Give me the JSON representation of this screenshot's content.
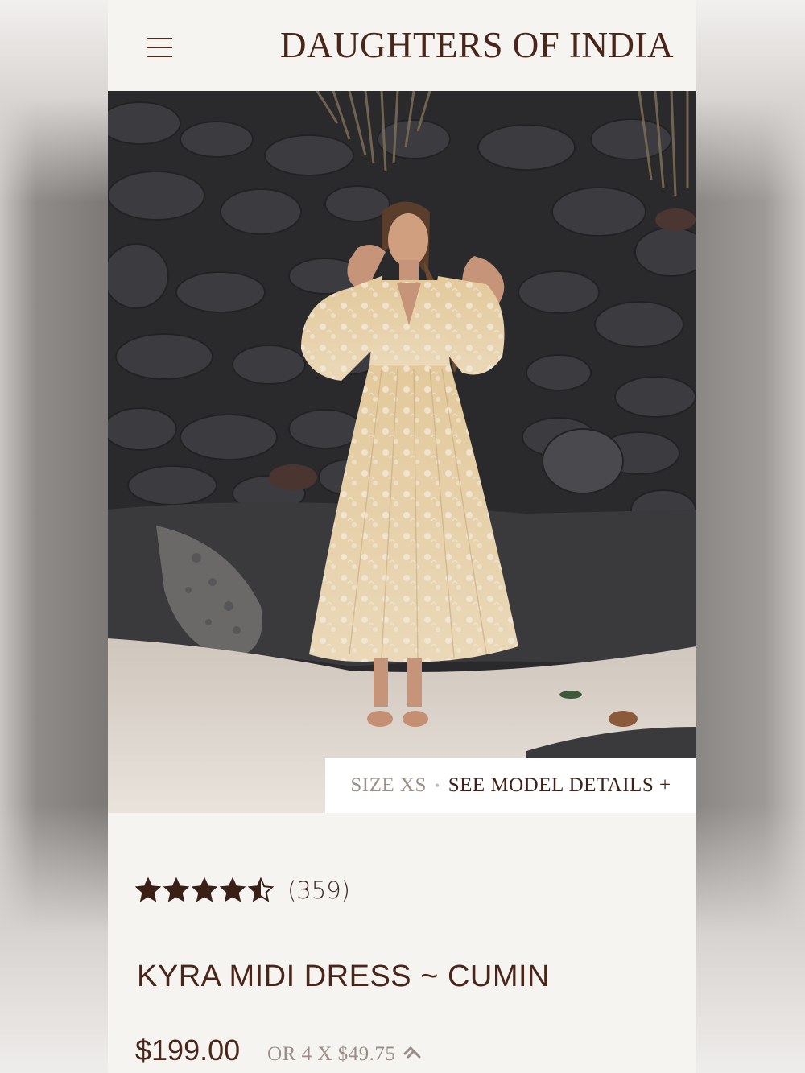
{
  "brand": {
    "name": "DAUGHTERS OF INDIA"
  },
  "hero": {
    "size_label": "SIZE XS",
    "separator": "•",
    "details_label": "SEE MODEL DETAILS +"
  },
  "product": {
    "rating_value": 4.5,
    "rating_max": 5,
    "review_count": "(359)",
    "title": "KYRA MIDI DRESS ~ CUMIN",
    "price": "$199.00",
    "installments": "OR 4 X $49.75"
  },
  "icons": {
    "menu": "hamburger-menu-icon",
    "star": "star-icon",
    "half_star": "half-star-icon",
    "installment": "afterpay-icon"
  },
  "colors": {
    "brand_text": "#4a2519",
    "page_background": "#f6f4f1",
    "muted_text": "#9a8d88",
    "star": "#3a1f16"
  }
}
